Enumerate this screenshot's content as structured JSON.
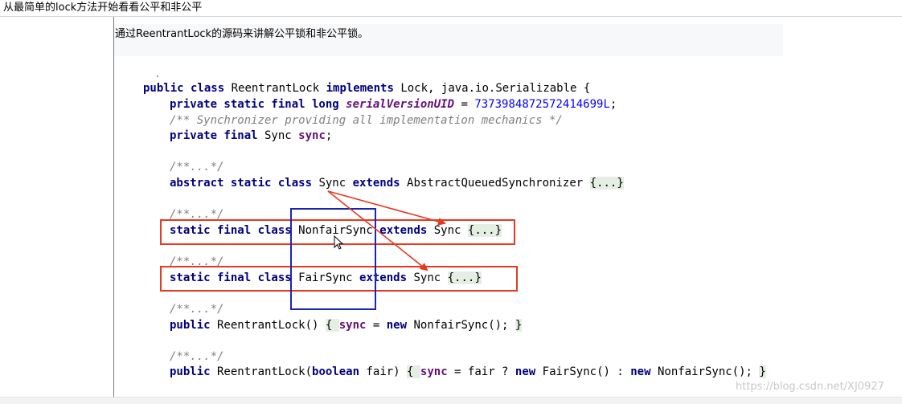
{
  "page_title": "从最简单的lock方法开始看看公平和非公平",
  "intro_text": "通过ReentrantLock的源码来讲解公平锁和非公平锁。",
  "code": {
    "l1": {
      "k1": "public class",
      "t1": " ReentrantLock ",
      "k2": "implements",
      "t2": " Lock, java.io.Serializable {"
    },
    "l2": {
      "k1": "private static final long",
      "sp": " ",
      "f1": "serialVersionUID",
      "t1": " = ",
      "n1": "7373984872572414699L",
      "t2": ";"
    },
    "l3": {
      "c1": "/** Synchronizer providing all implementation mechanics */"
    },
    "l4": {
      "k1": "private final",
      "t1": " Sync ",
      "f1": "sync",
      "t2": ";"
    },
    "l5": {
      "c1": "/**...*/"
    },
    "l6": {
      "k1": "abstract static class",
      "t1": " Sync ",
      "k2": "extends",
      "t2": " AbstractQueuedSynchronizer ",
      "fd": "{...}"
    },
    "l7": {
      "c1": "/**...*/"
    },
    "l8": {
      "k1": "static final class",
      "t1": " NonfairSync ",
      "k2": "extends",
      "t2": " Sync ",
      "fd": "{...}"
    },
    "l9": {
      "c1": "/**...*/"
    },
    "l10": {
      "k1": "static final class",
      "t1": " FairSync ",
      "k2": "extends",
      "t2": " Sync ",
      "fd": "{...}"
    },
    "l11": {
      "c1": "/**...*/"
    },
    "l12": {
      "k1": "public",
      "t1": " ReentrantLock() ",
      "fd1": "{ ",
      "f1": "sync",
      "t2": " = ",
      "k2": "new",
      "t3": " NonfairSync(); ",
      "fd2": "}"
    },
    "l13": {
      "c1": "/**...*/"
    },
    "l14": {
      "k1": "public",
      "t1": " ReentrantLock(",
      "k2": "boolean",
      "t2": " fair) ",
      "fd1": "{ ",
      "f1": "sync",
      "t3": " = fair ? ",
      "k3": "new",
      "t4": " FairSync() : ",
      "k4": "new",
      "t5": " NonfairSync(); ",
      "fd2": "}"
    }
  },
  "annotation_colors": {
    "highlight_box": "#e8381f",
    "column_box": "#1b25b0",
    "arrow": "#e8381f"
  },
  "watermark": "https://blog.csdn.net/XJ0927"
}
